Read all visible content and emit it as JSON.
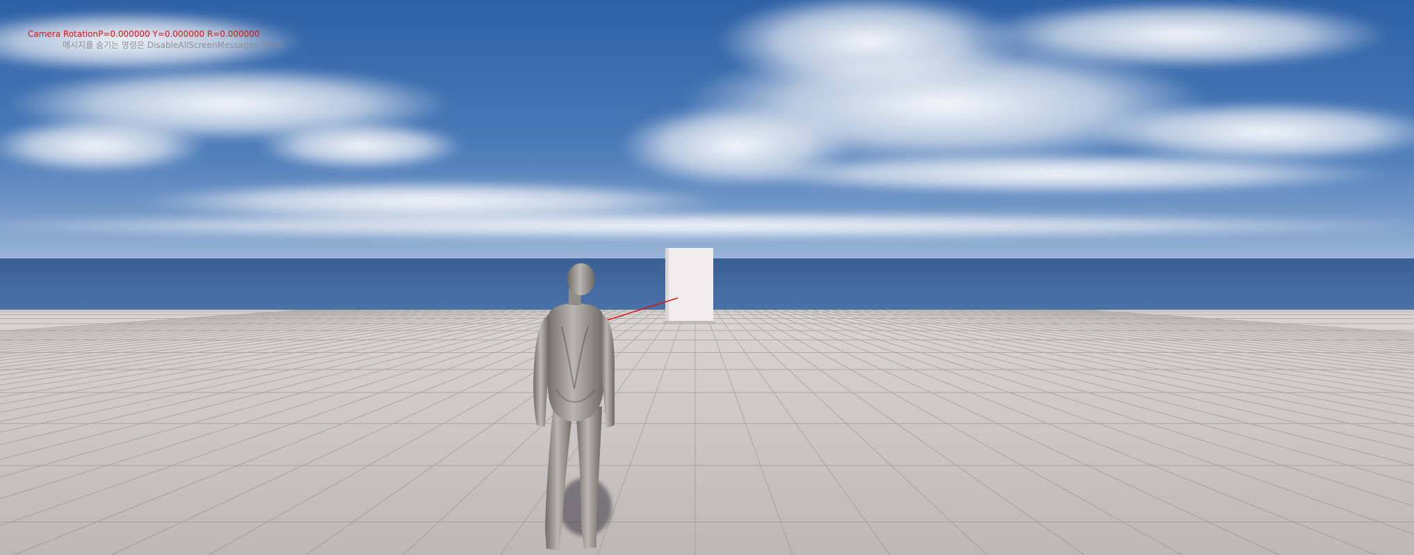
{
  "debug_messages": {
    "camera_rotation": "Camera RotationP=0.000000 Y=0.000000 R=0.000000",
    "disable_hint": "메시지를 숨기는 명령은 DisableAllScreenMessages 입니다."
  },
  "colors": {
    "sky_top": "#2f63a8",
    "sky_horizon": "#7fa3cf",
    "ocean": "#3e679f",
    "floor_tile_light": "#cfccca",
    "floor_tile_dark": "#aeaaa8",
    "character": "#9c9a92",
    "debug_primary": "#e01010",
    "debug_secondary": "#8a8f97"
  }
}
